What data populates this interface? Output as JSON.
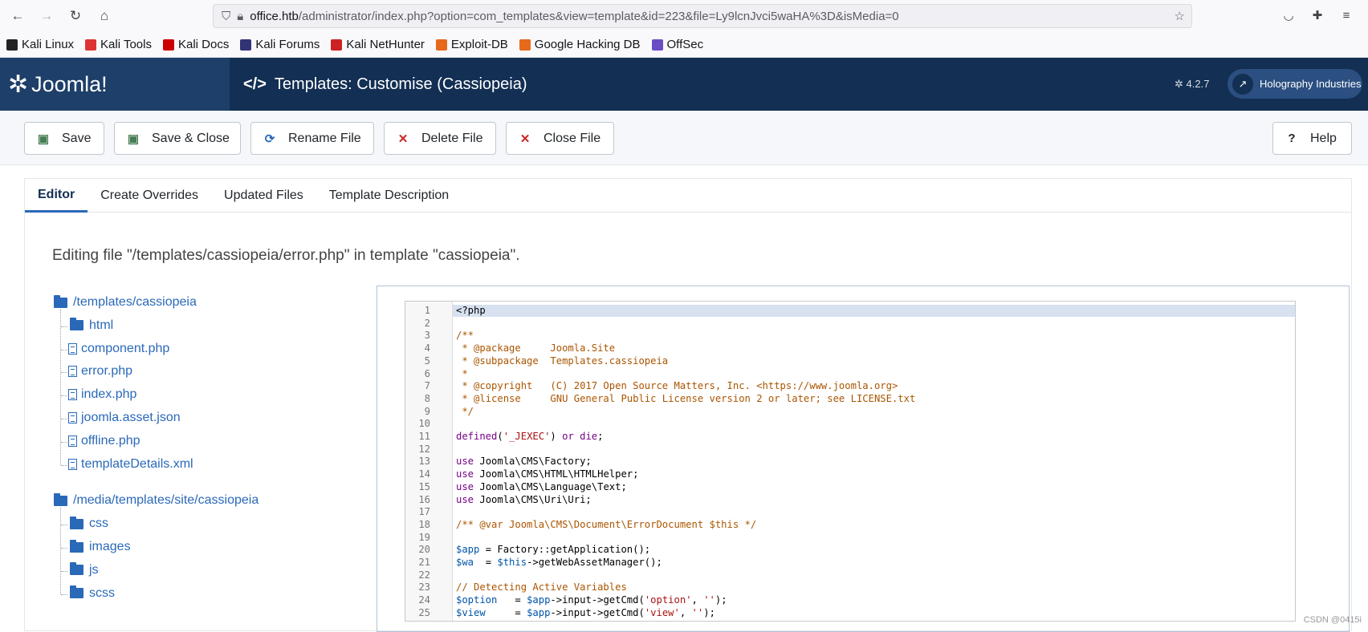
{
  "browser": {
    "url_host": "office.htb",
    "url_path": "/administrator/index.php?option=com_templates&view=template&id=223&file=Ly9lcnJvci5waHA%3D&isMedia=0"
  },
  "bookmarks": [
    {
      "label": "Kali Linux",
      "color": "#222"
    },
    {
      "label": "Kali Tools",
      "color": "#d33"
    },
    {
      "label": "Kali Docs",
      "color": "#c00"
    },
    {
      "label": "Kali Forums",
      "color": "#337"
    },
    {
      "label": "Kali NetHunter",
      "color": "#c22"
    },
    {
      "label": "Exploit-DB",
      "color": "#e56a1c"
    },
    {
      "label": "Google Hacking DB",
      "color": "#e56a1c"
    },
    {
      "label": "OffSec",
      "color": "#6a4cc4"
    }
  ],
  "header": {
    "logo": "Joomla!",
    "title": "Templates: Customise (Cassiopeia)",
    "version": "4.2.7",
    "site": "Holography Industries"
  },
  "toolbar": {
    "save": "Save",
    "save_close": "Save & Close",
    "rename": "Rename File",
    "delete": "Delete File",
    "close": "Close File",
    "help": "Help"
  },
  "tabs": [
    "Editor",
    "Create Overrides",
    "Updated Files",
    "Template Description"
  ],
  "editing_text": "Editing file \"/templates/cassiopeia/error.php\" in template \"cassiopeia\".",
  "tree": {
    "root1": "/templates/cassiopeia",
    "root1_items": [
      {
        "label": "html",
        "type": "folder"
      },
      {
        "label": "component.php",
        "type": "file"
      },
      {
        "label": "error.php",
        "type": "file"
      },
      {
        "label": "index.php",
        "type": "file"
      },
      {
        "label": "joomla.asset.json",
        "type": "file"
      },
      {
        "label": "offline.php",
        "type": "file"
      },
      {
        "label": "templateDetails.xml",
        "type": "file"
      }
    ],
    "root2": "/media/templates/site/cassiopeia",
    "root2_items": [
      {
        "label": "css",
        "type": "folder"
      },
      {
        "label": "images",
        "type": "folder"
      },
      {
        "label": "js",
        "type": "folder"
      },
      {
        "label": "scss",
        "type": "folder"
      }
    ]
  },
  "code_lines": [
    "<?php",
    "",
    "/**",
    " * @package     Joomla.Site",
    " * @subpackage  Templates.cassiopeia",
    " *",
    " * @copyright   (C) 2017 Open Source Matters, Inc. <https://www.joomla.org>",
    " * @license     GNU General Public License version 2 or later; see LICENSE.txt",
    " */",
    "",
    "defined('_JEXEC') or die;",
    "",
    "use Joomla\\CMS\\Factory;",
    "use Joomla\\CMS\\HTML\\HTMLHelper;",
    "use Joomla\\CMS\\Language\\Text;",
    "use Joomla\\CMS\\Uri\\Uri;",
    "",
    "/** @var Joomla\\CMS\\Document\\ErrorDocument $this */",
    "",
    "$app = Factory::getApplication();",
    "$wa  = $this->getWebAssetManager();",
    "",
    "// Detecting Active Variables",
    "$option   = $app->input->getCmd('option', '');",
    "$view     = $app->input->getCmd('view', '');"
  ],
  "watermark": "CSDN @0415i"
}
